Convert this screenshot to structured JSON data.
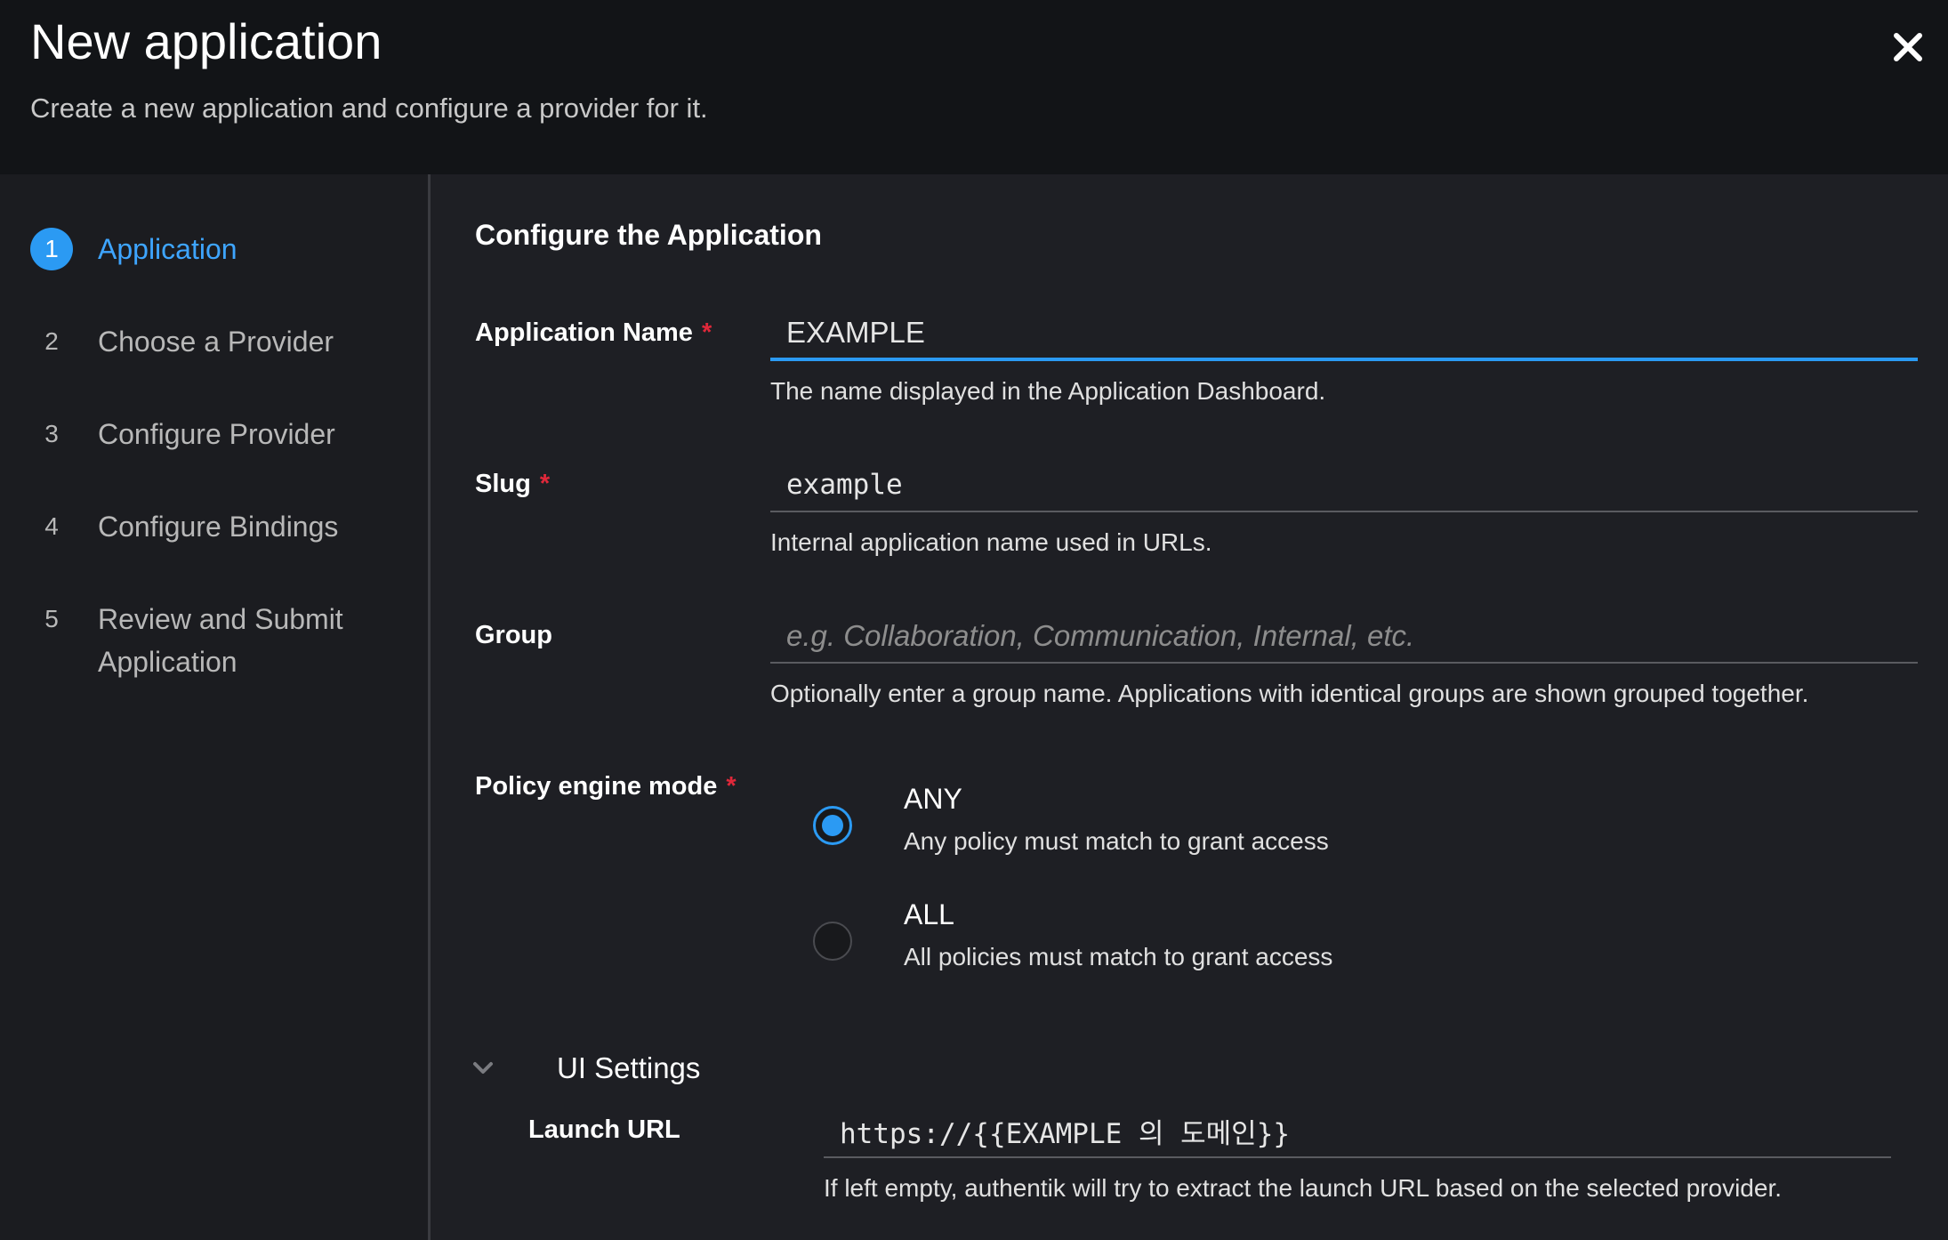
{
  "header": {
    "title": "New application",
    "subtitle": "Create a new application and configure a provider for it."
  },
  "steps": [
    {
      "number": "1",
      "label": "Application",
      "active": true
    },
    {
      "number": "2",
      "label": "Choose a Provider"
    },
    {
      "number": "3",
      "label": "Configure Provider"
    },
    {
      "number": "4",
      "label": "Configure Bindings"
    },
    {
      "number": "5",
      "label": "Review and Submit Application"
    }
  ],
  "form": {
    "section_title": "Configure the Application",
    "required_mark": "*",
    "app_name": {
      "label": "Application Name",
      "value": "EXAMPLE",
      "helper": "The name displayed in the Application Dashboard."
    },
    "slug": {
      "label": "Slug",
      "value": "example",
      "helper": "Internal application name used in URLs."
    },
    "group": {
      "label": "Group",
      "value": "",
      "placeholder": "e.g. Collaboration, Communication, Internal, etc.",
      "helper": "Optionally enter a group name. Applications with identical groups are shown grouped together."
    },
    "policy": {
      "label": "Policy engine mode",
      "options": [
        {
          "title": "ANY",
          "description": "Any policy must match to grant access",
          "checked": true
        },
        {
          "title": "ALL",
          "description": "All policies must match to grant access",
          "checked": false
        }
      ]
    },
    "ui_settings": {
      "label": "UI Settings",
      "launch_url": {
        "label": "Launch URL",
        "value": "https://{{EXAMPLE 의 도메인}}",
        "helper": "If left empty, authentik will try to extract the launch URL based on the selected provider."
      }
    }
  },
  "colors": {
    "accent": "#2b9af3",
    "required": "#e0283a",
    "header_bg": "#121417",
    "body_bg": "#1e1f24"
  },
  "icons": {
    "close": "close-icon",
    "chevron": "chevron-down-icon"
  }
}
